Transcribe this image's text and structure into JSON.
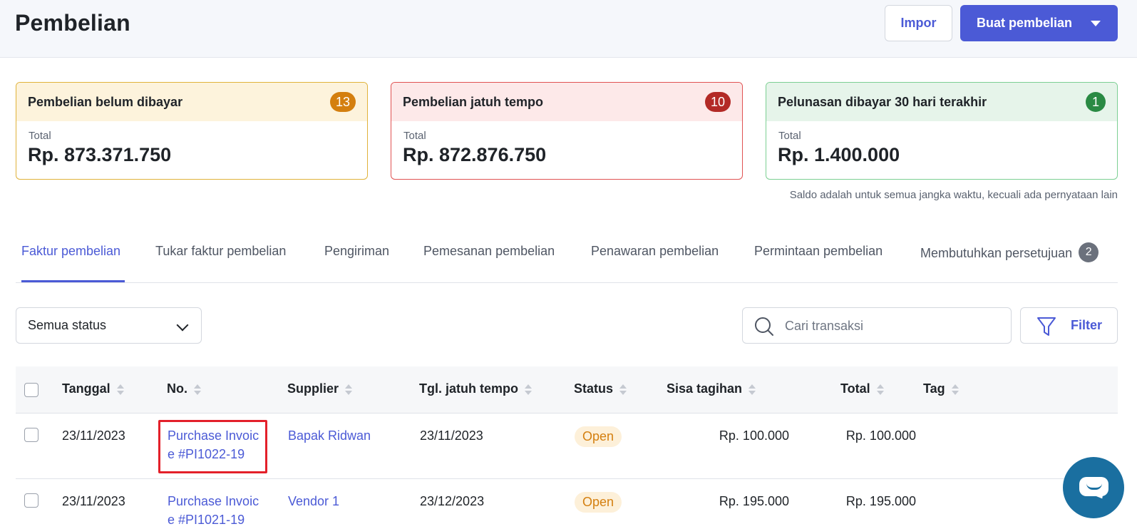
{
  "header": {
    "title": "Pembelian",
    "import_label": "Impor",
    "create_label": "Buat pembelian"
  },
  "cards": [
    {
      "title": "Pembelian belum dibayar",
      "count": "13",
      "label": "Total",
      "value": "Rp. 873.371.750",
      "color": "#d47f0f"
    },
    {
      "title": "Pembelian jatuh tempo",
      "count": "10",
      "label": "Total",
      "value": "Rp. 872.876.750",
      "color": "#b32a26"
    },
    {
      "title": "Pelunasan dibayar 30 hari terakhir",
      "count": "1",
      "label": "Total",
      "value": "Rp. 1.400.000",
      "color": "#2a8a44"
    }
  ],
  "note": "Saldo adalah untuk semua jangka waktu, kecuali ada pernyataan lain",
  "tabs": [
    {
      "label": "Faktur pembelian",
      "active": true
    },
    {
      "label": "Tukar faktur pembelian"
    },
    {
      "label": "Pengiriman"
    },
    {
      "label": "Pemesanan pembelian"
    },
    {
      "label": "Penawaran pembelian"
    },
    {
      "label": "Permintaan pembelian"
    },
    {
      "label": "Membutuhkan persetujuan",
      "count": "2"
    }
  ],
  "filters": {
    "status_value": "Semua status",
    "search_placeholder": "Cari transaksi",
    "filter_label": "Filter"
  },
  "table": {
    "columns": [
      "Tanggal",
      "No.",
      "Supplier",
      "Tgl. jatuh tempo",
      "Status",
      "Sisa tagihan",
      "Total",
      "Tag"
    ],
    "rows": [
      {
        "date": "23/11/2023",
        "number": "Purchase Invoice #PI1022-19",
        "supplier": "Bapak Ridwan",
        "due": "23/11/2023",
        "status": "Open",
        "balance": "Rp. 100.000",
        "total": "Rp. 100.000",
        "tag": ""
      },
      {
        "date": "23/11/2023",
        "number": "Purchase Invoice #PI1021-19",
        "supplier": "Vendor 1",
        "due": "23/12/2023",
        "status": "Open",
        "balance": "Rp. 195.000",
        "total": "Rp. 195.000",
        "tag": ""
      }
    ]
  },
  "colors": {
    "accent": "#4b5ad6",
    "highlight": "#e3202a",
    "chat": "#1a6fa0"
  }
}
